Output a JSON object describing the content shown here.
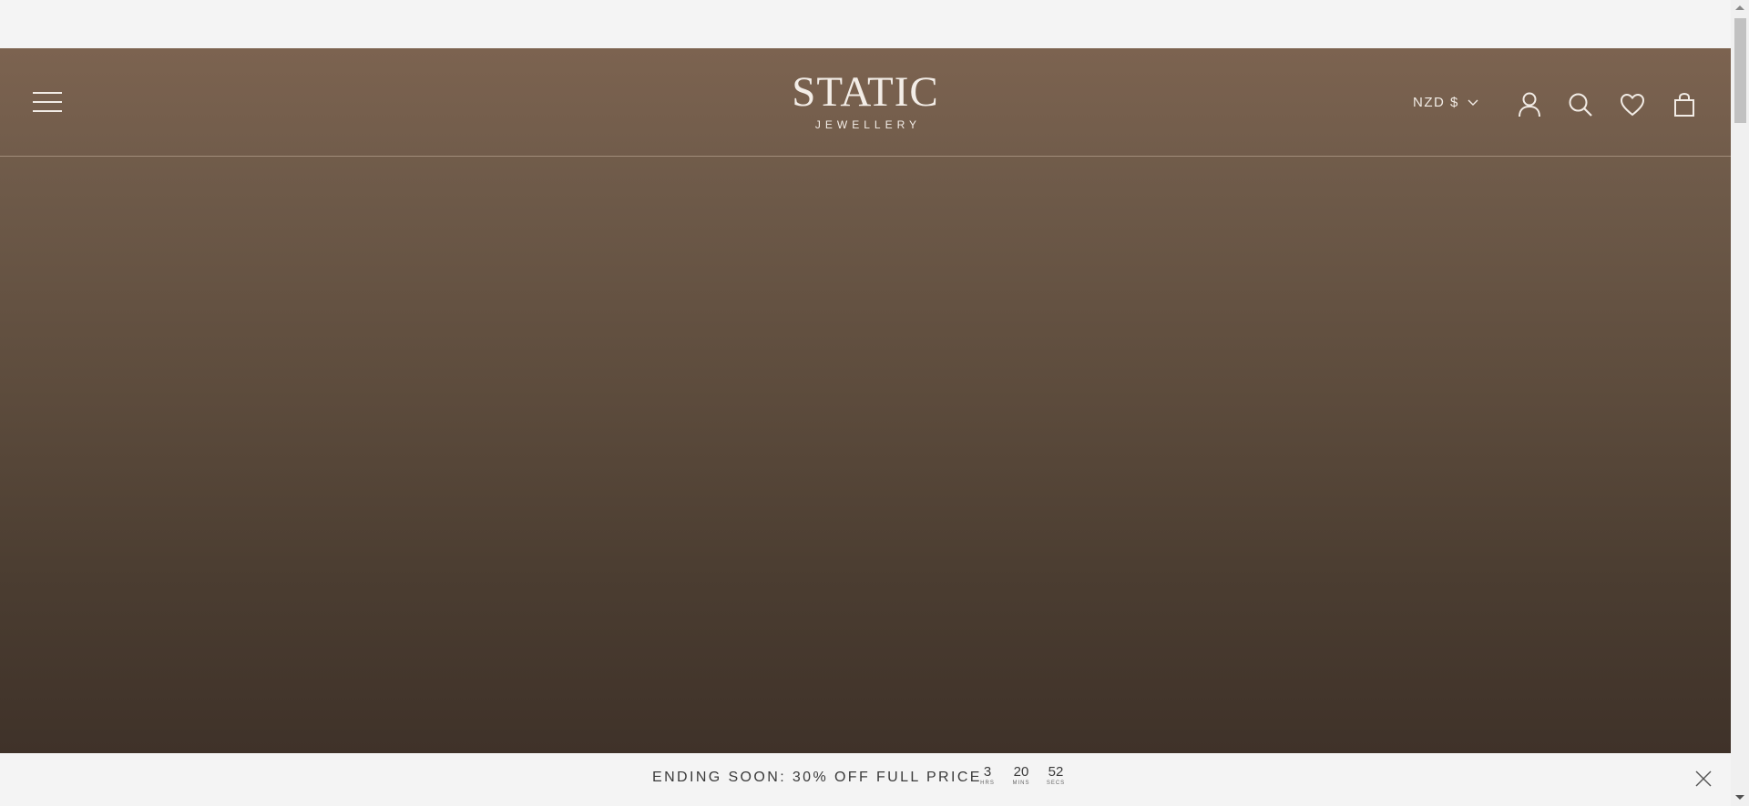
{
  "header": {
    "logo_main": "STATIC",
    "logo_sub": "JEWELLERY",
    "currency": "NZD $",
    "icons": [
      "menu-icon",
      "account-icon",
      "search-icon",
      "wishlist-heart-icon",
      "cart-bag-icon"
    ]
  },
  "promo": {
    "text": "ENDING SOON: 30% OFF FULL PRICE",
    "timer": [
      {
        "value": "3",
        "label": "HRS"
      },
      {
        "value": "20",
        "label": "MINS"
      },
      {
        "value": "52",
        "label": "SECS"
      }
    ]
  },
  "colors": {
    "header_text": "#f2ece6",
    "hero_top": "#7c6350",
    "hero_bottom": "#3f3229",
    "page_bg": "#f4f4f4"
  }
}
